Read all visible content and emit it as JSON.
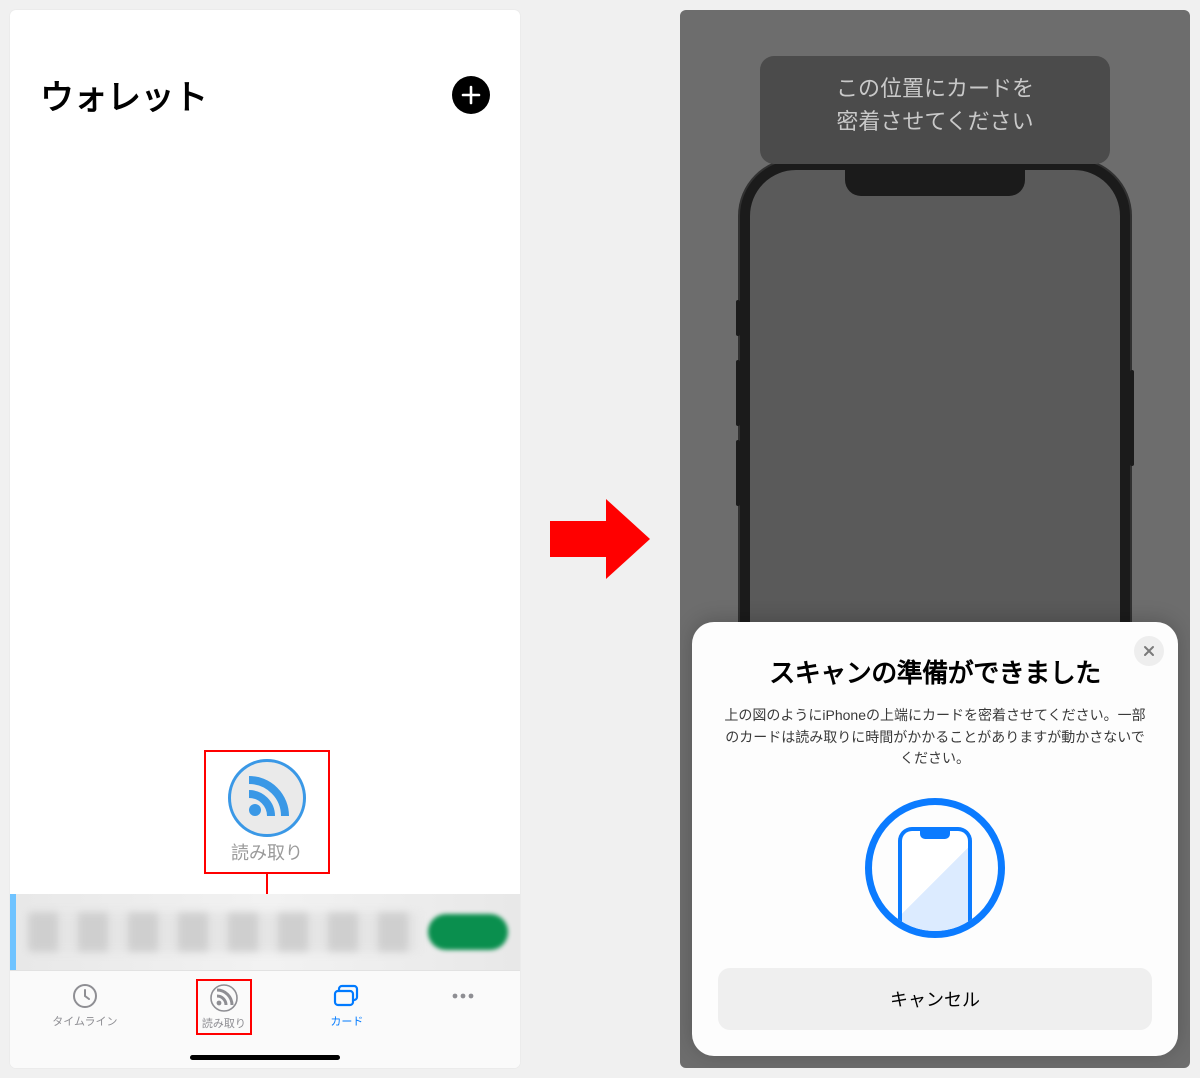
{
  "left": {
    "title": "ウォレット",
    "callout_label": "読み取り",
    "tabs": {
      "timeline": "タイムライン",
      "read": "読み取り",
      "card": "カード"
    }
  },
  "right": {
    "tooltip_line1": "この位置にカードを",
    "tooltip_line2": "密着させてください",
    "sheet_title": "スキャンの準備ができました",
    "sheet_desc": "上の図のようにiPhoneの上端にカードを密着させてください。一部のカードは読み取りに時間がかかることがありますが動かさないでください。",
    "cancel": "キャンセル"
  }
}
